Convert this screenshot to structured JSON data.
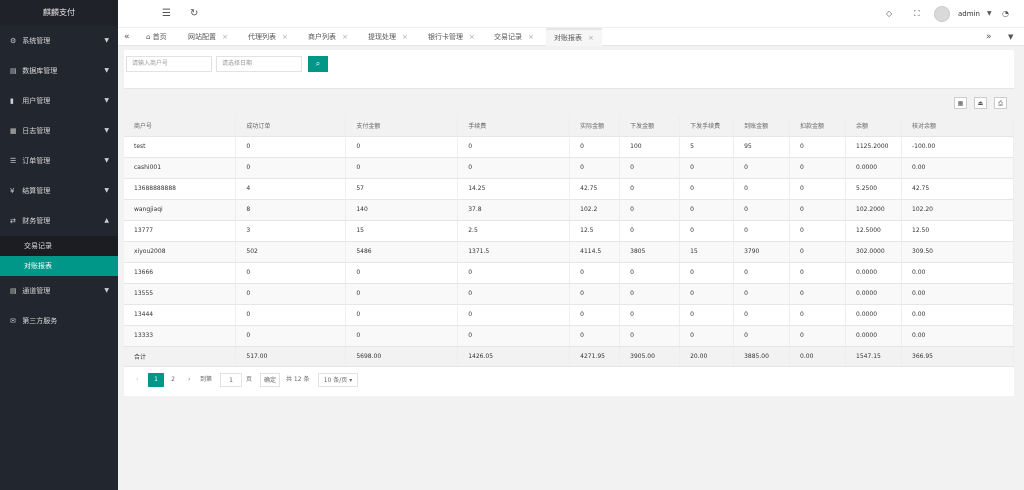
{
  "app": {
    "title": "麒麟支付"
  },
  "sidebar": {
    "items": [
      {
        "label": "系统管理",
        "icon": "gear-icon",
        "glyph": "⚙"
      },
      {
        "label": "数据库管理",
        "icon": "database-icon",
        "glyph": "▤"
      },
      {
        "label": "用户管理",
        "icon": "user-icon",
        "glyph": "▮"
      },
      {
        "label": "日志管理",
        "icon": "log-icon",
        "glyph": "▦"
      },
      {
        "label": "订单管理",
        "icon": "order-icon",
        "glyph": "☰"
      },
      {
        "label": "结算管理",
        "icon": "yen-icon",
        "glyph": "¥"
      },
      {
        "label": "财务管理",
        "icon": "transfer-icon",
        "glyph": "⇄"
      }
    ],
    "finance_sub": [
      {
        "label": "交易记录"
      },
      {
        "label": "对账报表"
      }
    ],
    "items_after": [
      {
        "label": "通道管理",
        "icon": "channel-icon",
        "glyph": "▤"
      },
      {
        "label": "第三方服务",
        "icon": "mail-icon",
        "glyph": "✉"
      }
    ]
  },
  "header": {
    "user": "admin"
  },
  "tabs": [
    {
      "label": "首页"
    },
    {
      "label": "网站配置"
    },
    {
      "label": "代理列表"
    },
    {
      "label": "商户列表"
    },
    {
      "label": "提现处理"
    },
    {
      "label": "银行卡管理"
    },
    {
      "label": "交易记录"
    },
    {
      "label": "对账报表"
    }
  ],
  "search": {
    "merchant_placeholder": "请输入商户号",
    "date_placeholder": "请选择日期"
  },
  "table": {
    "headers": [
      "商户号",
      "成功订单",
      "支付金额",
      "手续费",
      "实际金额",
      "下发金额",
      "下发手续费",
      "到账金额",
      "扣款金额",
      "余额",
      "核对余额"
    ],
    "rows": [
      [
        "test",
        "0",
        "0",
        "0",
        "0",
        "100",
        "5",
        "95",
        "0",
        "1125.2000",
        "-100.00"
      ],
      [
        "cashi001",
        "0",
        "0",
        "0",
        "0",
        "0",
        "0",
        "0",
        "0",
        "0.0000",
        "0.00"
      ],
      [
        "13688888888",
        "4",
        "57",
        "14.25",
        "42.75",
        "0",
        "0",
        "0",
        "0",
        "5.2500",
        "42.75"
      ],
      [
        "wangjiaqi",
        "8",
        "140",
        "37.8",
        "102.2",
        "0",
        "0",
        "0",
        "0",
        "102.2000",
        "102.20"
      ],
      [
        "13777",
        "3",
        "15",
        "2.5",
        "12.5",
        "0",
        "0",
        "0",
        "0",
        "12.5000",
        "12.50"
      ],
      [
        "xiyou2008",
        "502",
        "5486",
        "1371.5",
        "4114.5",
        "3805",
        "15",
        "3790",
        "0",
        "302.0000",
        "309.50"
      ],
      [
        "13666",
        "0",
        "0",
        "0",
        "0",
        "0",
        "0",
        "0",
        "0",
        "0.0000",
        "0.00"
      ],
      [
        "13555",
        "0",
        "0",
        "0",
        "0",
        "0",
        "0",
        "0",
        "0",
        "0.0000",
        "0.00"
      ],
      [
        "13444",
        "0",
        "0",
        "0",
        "0",
        "0",
        "0",
        "0",
        "0",
        "0.0000",
        "0.00"
      ],
      [
        "13333",
        "0",
        "0",
        "0",
        "0",
        "0",
        "0",
        "0",
        "0",
        "0.0000",
        "0.00"
      ]
    ],
    "total": [
      "合计",
      "517.00",
      "5698.00",
      "1426.05",
      "4271.95",
      "3905.00",
      "20.00",
      "3885.00",
      "0.00",
      "1547.15",
      "366.95"
    ]
  },
  "pager": {
    "page1": "1",
    "page2": "2",
    "goto_label": "到第",
    "goto_value": "1",
    "page_unit": "页",
    "confirm": "确定",
    "total": "共 12 条",
    "page_size": "10 条/页"
  }
}
